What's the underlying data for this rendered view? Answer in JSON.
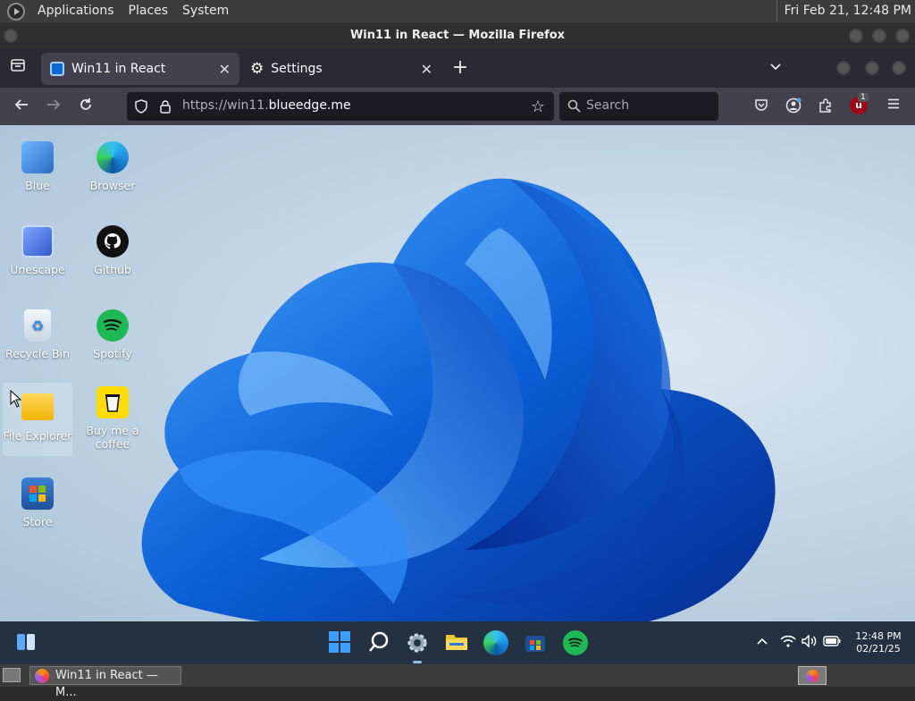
{
  "system_panel": {
    "menus": [
      "Applications",
      "Places",
      "System"
    ],
    "clock": "Fri Feb 21, 12:48 PM"
  },
  "window": {
    "title": "Win11 in React — Mozilla Firefox"
  },
  "tabs": [
    {
      "label": "Win11 in React",
      "active": true
    },
    {
      "label": "Settings",
      "active": false
    }
  ],
  "navbar": {
    "url_prefix": "https://win11.",
    "url_domain": "blueedge.me",
    "search_placeholder": "Search",
    "extension_badge": "1"
  },
  "desktop_icons": [
    {
      "label": "Blue"
    },
    {
      "label": "Browser"
    },
    {
      "label": "Unescape"
    },
    {
      "label": "Github"
    },
    {
      "label": "Recycle Bin"
    },
    {
      "label": "Spotify"
    },
    {
      "label": "File Explorer"
    },
    {
      "label": "Buy me a coffee"
    },
    {
      "label": "Store"
    }
  ],
  "taskbar": {
    "time": "12:48 PM",
    "date": "02/21/25"
  },
  "bottom_panel": {
    "task_label": "Win11 in React — M..."
  },
  "colors": {
    "accent": "#0a5fd6",
    "taskbar": "#233140"
  }
}
